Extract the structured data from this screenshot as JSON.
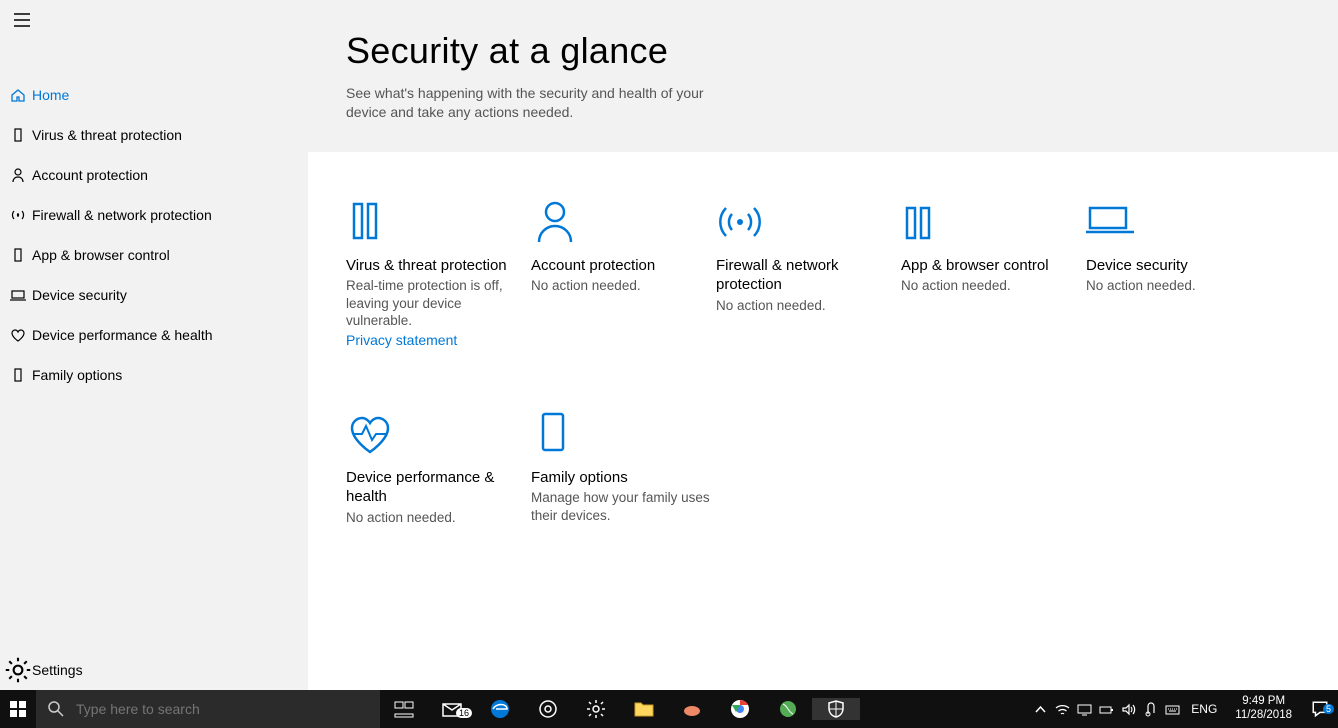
{
  "sidebar": {
    "items": [
      {
        "label": "Home",
        "icon": "home-icon",
        "active": true
      },
      {
        "label": "Virus & threat protection",
        "icon": "shield-icon"
      },
      {
        "label": "Account protection",
        "icon": "person-icon"
      },
      {
        "label": "Firewall & network protection",
        "icon": "antenna-icon"
      },
      {
        "label": "App & browser control",
        "icon": "app-icon"
      },
      {
        "label": "Device security",
        "icon": "device-icon"
      },
      {
        "label": "Device performance & health",
        "icon": "heart-icon"
      },
      {
        "label": "Family options",
        "icon": "family-icon"
      }
    ],
    "settings_label": "Settings"
  },
  "header": {
    "title": "Security at a glance",
    "subtitle": "See what's happening with the security and health of your device and take any actions needed."
  },
  "cards": [
    {
      "title": "Virus & threat protection",
      "desc": "Real-time protection is off, leaving your device vulnerable.",
      "link": "Privacy statement",
      "icon": "shield-icon"
    },
    {
      "title": "Account protection",
      "desc": "No action needed.",
      "icon": "person-icon"
    },
    {
      "title": "Firewall & network protection",
      "desc": "No action needed.",
      "icon": "antenna-icon"
    },
    {
      "title": "App & browser control",
      "desc": "No action needed.",
      "icon": "app-icon"
    },
    {
      "title": "Device security",
      "desc": "No action needed.",
      "icon": "device-icon"
    },
    {
      "title": "Device performance & health",
      "desc": "No action needed.",
      "icon": "heart-icon"
    },
    {
      "title": "Family options",
      "desc": "Manage how your family uses their devices.",
      "icon": "family-icon"
    }
  ],
  "taskbar": {
    "search_placeholder": "Type here to search",
    "mail_badge": "16",
    "lang": "ENG",
    "time": "9:49 PM",
    "date": "11/28/2018",
    "action_center_badge": "5"
  }
}
